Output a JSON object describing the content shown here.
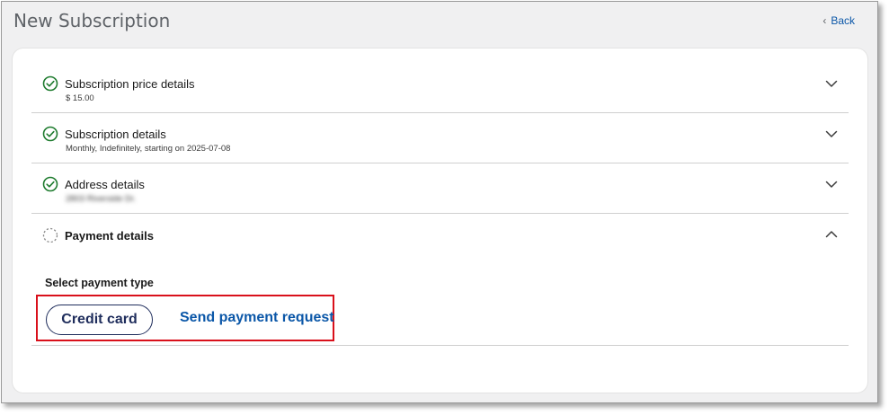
{
  "header": {
    "title": "New Subscription",
    "back_label": "Back",
    "back_icon": "chevron-left-icon"
  },
  "sections": [
    {
      "title": "Subscription price details",
      "subtitle": "$ 15.00",
      "status": "complete",
      "expanded": false
    },
    {
      "title": "Subscription details",
      "subtitle": "Monthly, Indefinitely, starting on 2025-07-08",
      "status": "complete",
      "expanded": false
    },
    {
      "title": "Address details",
      "subtitle": "2803 Riverside Dr.",
      "subtitle_blurred": true,
      "status": "complete",
      "expanded": false
    },
    {
      "title": "Payment details",
      "status": "pending",
      "expanded": true
    }
  ],
  "payment": {
    "select_label": "Select payment type",
    "credit_card_label": "Credit card",
    "send_request_label": "Send payment request"
  },
  "colors": {
    "accent_link": "#0b57a8",
    "complete_green": "#1e7b2e",
    "button_navy": "#1f2d5c",
    "highlight_red": "#d9101b",
    "page_background": "#f0f0f1"
  }
}
